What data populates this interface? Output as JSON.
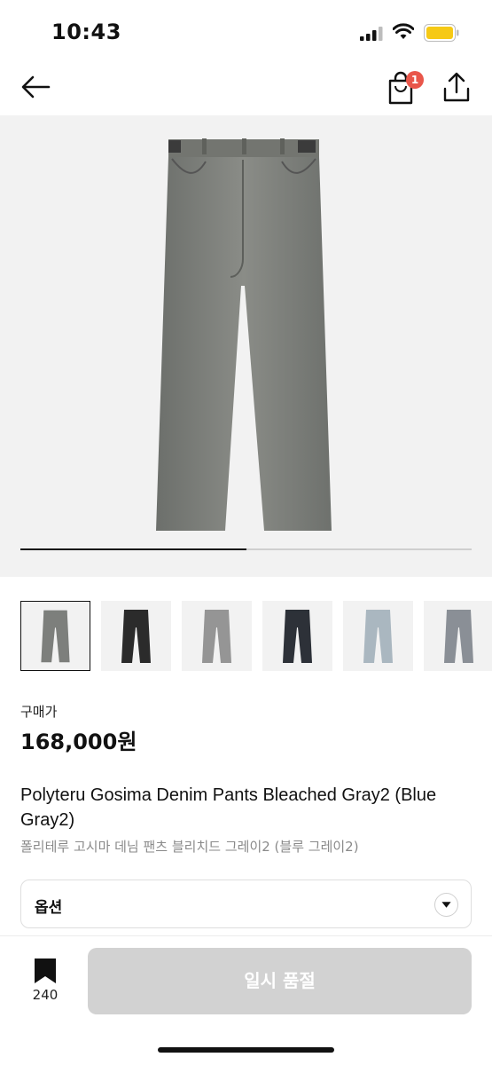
{
  "status_bar": {
    "time": "10:43"
  },
  "nav": {
    "cart_count": "1"
  },
  "gallery": {
    "progress": 0.5,
    "thumbnails": [
      {
        "name": "thumb-bleached-gray2",
        "color": "#7d7f7c",
        "selected": true
      },
      {
        "name": "thumb-black",
        "color": "#2b2b2b",
        "selected": false
      },
      {
        "name": "thumb-faded-gray",
        "color": "#959595",
        "selected": false
      },
      {
        "name": "thumb-dark-navy",
        "color": "#2d3138",
        "selected": false
      },
      {
        "name": "thumb-light-blue",
        "color": "#aab7c0",
        "selected": false
      },
      {
        "name": "thumb-blue-gray",
        "color": "#8a8f96",
        "selected": false
      }
    ]
  },
  "product": {
    "price_label": "구매가",
    "price": "168,000원",
    "title": "Polyteru Gosima Denim Pants Bleached Gray2 (Blue Gray2)",
    "subtitle": "폴리테루 고시마 데님 팬츠 블리치드 그레이2 (블루 그레이2)"
  },
  "options": {
    "label": "옵션"
  },
  "bottom_bar": {
    "wishlist_count": "240",
    "buy_label": "일시 품절"
  },
  "colors": {
    "badge": "#e9564a",
    "disabled_button": "#d2d2d2",
    "battery": "#f6c915"
  },
  "icons": [
    "signal-icon",
    "wifi-icon",
    "battery-icon",
    "back-arrow-icon",
    "shopping-bag-icon",
    "share-icon",
    "chevron-down-icon",
    "bookmark-icon"
  ]
}
